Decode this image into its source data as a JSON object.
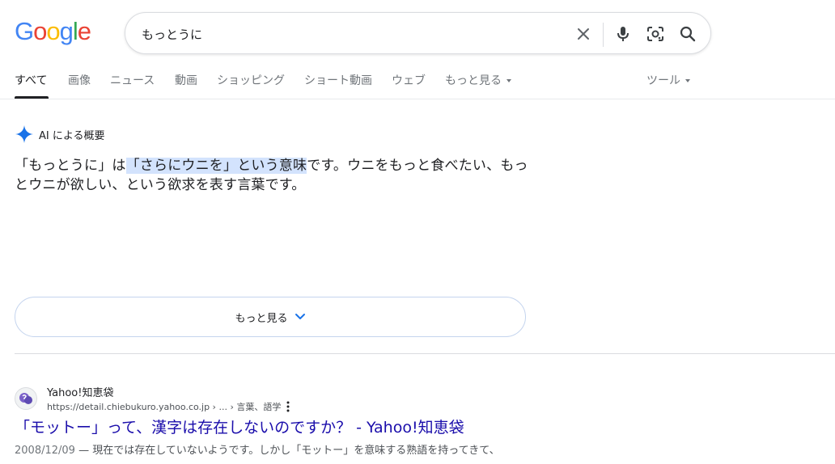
{
  "logo": {
    "letters": [
      "G",
      "o",
      "o",
      "g",
      "l",
      "e"
    ],
    "colors": [
      "#4285f4",
      "#ea4335",
      "#fbbc05",
      "#4285f4",
      "#34a853",
      "#ea4335"
    ]
  },
  "search": {
    "value": "もっとうに"
  },
  "icons": {
    "clear": "close-icon",
    "voice": "microphone-icon",
    "lens": "camera-lens-icon",
    "submit": "search-icon"
  },
  "tabs": {
    "all": "すべて",
    "images": "画像",
    "news": "ニュース",
    "videos": "動画",
    "shopping": "ショッピング",
    "shorts": "ショート動画",
    "web": "ウェブ",
    "more": "もっと見る",
    "tools": "ツール"
  },
  "ai_overview": {
    "title": "AI による概要",
    "text_before": "「もっとうに」は",
    "text_highlight": "「さらにウニを」という意味",
    "text_after": "です。ウニをもっと食べたい、もっとウニが欲しい、という欲求を表す言葉です。",
    "more_label": "もっと見る"
  },
  "result": {
    "site_name": "Yahoo!知恵袋",
    "url": "https://detail.chiebukuro.yahoo.co.jp › ... › 言葉、語学",
    "title": "「モットー」って、漢字は存在しないのですか？ - Yahoo!知恵袋",
    "date": "2008/12/09",
    "snippet": " — 現在では存在していないようです。しかし「モットー」を意味する熟語を持ってきて、"
  },
  "colors": {
    "accent_blue": "#1a73e8",
    "link": "#1a0dab",
    "highlight": "#d3e3fd"
  }
}
